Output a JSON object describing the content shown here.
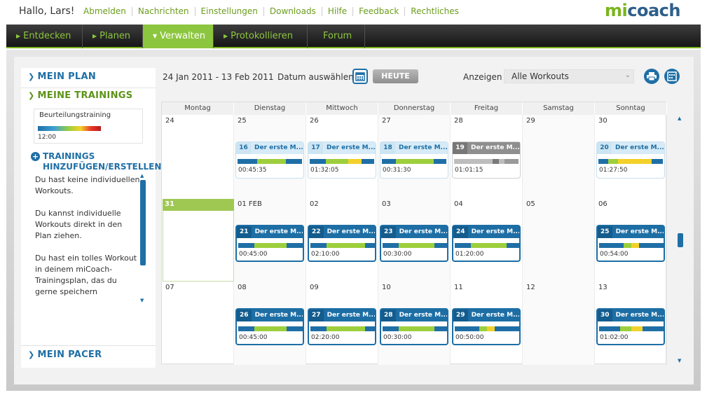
{
  "header": {
    "greeting": "Hallo, Lars!",
    "links": [
      "Abmelden",
      "Nachrichten",
      "Einstellungen",
      "Downloads",
      "Hilfe",
      "Feedback",
      "Rechtliches"
    ],
    "logo_mi": "mi",
    "logo_coach": "coach"
  },
  "nav": {
    "items": [
      "Entdecken",
      "Planen",
      "Verwalten",
      "Protokollieren",
      "Forum"
    ],
    "active": "Verwalten"
  },
  "sidebar": {
    "my_plan": "MEIN PLAN",
    "my_trainings": "MEINE TRAININGS",
    "training_card": {
      "name": "Beurteilungstraining",
      "time": "12:00"
    },
    "add_line1": "TRAININGS",
    "add_line2": "HINZUFÜGEN/ERSTELLEN",
    "paragraphs": [
      "Du hast keine individuellen Workouts.",
      "Du kannst individuelle Workouts direkt in den Plan ziehen.",
      "Du hast ein tolles Workout in deinem miCoach-Trainingsplan, das du gerne speichern"
    ],
    "my_pacer": "MEIN PACER"
  },
  "calendar": {
    "range": "24 Jan 2011 - 13 Feb 2011",
    "select_date": "Datum auswählen",
    "today": "HEUTE",
    "show_label": "Anzeigen",
    "show_value": "Alle Workouts",
    "days": [
      "Montag",
      "Dienstag",
      "Mittwoch",
      "Donnerstag",
      "Freitag",
      "Samstag",
      "Sonntag"
    ],
    "dates": [
      [
        "24",
        "25",
        "26",
        "27",
        "28",
        "29",
        "30"
      ],
      [
        "31",
        "01 FEB",
        "02",
        "03",
        "04",
        "05",
        "06"
      ],
      [
        "07",
        "08",
        "09",
        "10",
        "11",
        "12",
        "13"
      ]
    ],
    "workouts": [
      {
        "week": 0,
        "day": 1,
        "num": "16",
        "title": "Der erste M...",
        "time": "00:45:35",
        "style": "suggest",
        "bar": [
          [
            30,
            "#1f6fa6"
          ],
          [
            45,
            "#9dcf3c"
          ],
          [
            25,
            "#1f6fa6"
          ]
        ]
      },
      {
        "week": 0,
        "day": 2,
        "num": "17",
        "title": "Der erste M...",
        "time": "01:32:05",
        "style": "suggest",
        "bar": [
          [
            25,
            "#1f6fa6"
          ],
          [
            35,
            "#9dcf3c"
          ],
          [
            20,
            "#f3d12a"
          ],
          [
            20,
            "#1f6fa6"
          ]
        ]
      },
      {
        "week": 0,
        "day": 3,
        "num": "18",
        "title": "Der erste M...",
        "time": "00:31:30",
        "style": "suggest",
        "bar": [
          [
            22,
            "#1f6fa6"
          ],
          [
            58,
            "#9dcf3c"
          ],
          [
            20,
            "#1f6fa6"
          ]
        ]
      },
      {
        "week": 0,
        "day": 4,
        "num": "19",
        "title": "Der erste M...",
        "time": "01:01:15",
        "style": "gray",
        "bar": [
          [
            60,
            "#bdbdbd"
          ],
          [
            10,
            "#7a7a7a"
          ],
          [
            8,
            "#bdbdbd"
          ],
          [
            22,
            "#9a9a9a"
          ]
        ]
      },
      {
        "week": 0,
        "day": 6,
        "num": "20",
        "title": "Der erste M...",
        "time": "01:27:50",
        "style": "suggest",
        "bar": [
          [
            15,
            "#1f6fa6"
          ],
          [
            15,
            "#9dcf3c"
          ],
          [
            53,
            "#f3d12a"
          ],
          [
            17,
            "#1f6fa6"
          ]
        ]
      },
      {
        "week": 1,
        "day": 1,
        "num": "21",
        "title": "Der erste M...",
        "time": "00:45:00",
        "style": "planned",
        "bar": [
          [
            25,
            "#1f6fa6"
          ],
          [
            50,
            "#9dcf3c"
          ],
          [
            25,
            "#1f6fa6"
          ]
        ]
      },
      {
        "week": 1,
        "day": 2,
        "num": "22",
        "title": "Der erste M...",
        "time": "02:10:00",
        "style": "planned",
        "bar": [
          [
            25,
            "#1f6fa6"
          ],
          [
            60,
            "#9dcf3c"
          ],
          [
            15,
            "#1f6fa6"
          ]
        ]
      },
      {
        "week": 1,
        "day": 3,
        "num": "23",
        "title": "Der erste M...",
        "time": "00:30:00",
        "style": "planned",
        "bar": [
          [
            25,
            "#1f6fa6"
          ],
          [
            55,
            "#9dcf3c"
          ],
          [
            20,
            "#1f6fa6"
          ]
        ]
      },
      {
        "week": 1,
        "day": 4,
        "num": "24",
        "title": "Der erste M...",
        "time": "01:20:00",
        "style": "planned",
        "bar": [
          [
            25,
            "#1f6fa6"
          ],
          [
            55,
            "#9dcf3c"
          ],
          [
            20,
            "#1f6fa6"
          ]
        ]
      },
      {
        "week": 1,
        "day": 6,
        "num": "25",
        "title": "Der erste M...",
        "time": "00:54:00",
        "style": "planned",
        "bar": [
          [
            38,
            "#1f6fa6"
          ],
          [
            12,
            "#9dcf3c"
          ],
          [
            12,
            "#f3d12a"
          ],
          [
            38,
            "#1f6fa6"
          ]
        ]
      },
      {
        "week": 2,
        "day": 1,
        "num": "26",
        "title": "Der erste M...",
        "time": "00:45:00",
        "style": "planned",
        "bar": [
          [
            25,
            "#1f6fa6"
          ],
          [
            50,
            "#9dcf3c"
          ],
          [
            25,
            "#1f6fa6"
          ]
        ]
      },
      {
        "week": 2,
        "day": 2,
        "num": "27",
        "title": "Der erste M...",
        "time": "02:20:00",
        "style": "planned",
        "bar": [
          [
            25,
            "#1f6fa6"
          ],
          [
            60,
            "#9dcf3c"
          ],
          [
            15,
            "#1f6fa6"
          ]
        ]
      },
      {
        "week": 2,
        "day": 3,
        "num": "28",
        "title": "Der erste M...",
        "time": "00:30:00",
        "style": "planned",
        "bar": [
          [
            25,
            "#1f6fa6"
          ],
          [
            55,
            "#9dcf3c"
          ],
          [
            20,
            "#1f6fa6"
          ]
        ]
      },
      {
        "week": 2,
        "day": 4,
        "num": "29",
        "title": "Der erste M...",
        "time": "00:50:00",
        "style": "planned",
        "bar": [
          [
            38,
            "#1f6fa6"
          ],
          [
            12,
            "#9dcf3c"
          ],
          [
            12,
            "#f3d12a"
          ],
          [
            38,
            "#1f6fa6"
          ]
        ]
      },
      {
        "week": 2,
        "day": 6,
        "num": "30",
        "title": "Der erste M...",
        "time": "01:02:00",
        "style": "planned",
        "bar": [
          [
            33,
            "#1f6fa6"
          ],
          [
            17,
            "#9dcf3c"
          ],
          [
            17,
            "#f3d12a"
          ],
          [
            33,
            "#1f6fa6"
          ]
        ]
      }
    ]
  },
  "colors": {
    "accent_green": "#7ab51d",
    "accent_blue": "#1f6fa6",
    "nav_bg": "#1e1e1e"
  },
  "icons": [
    "calendar-icon",
    "print-icon",
    "export-icon",
    "plus-icon",
    "chevron-right-icon",
    "chevron-down-icon"
  ]
}
